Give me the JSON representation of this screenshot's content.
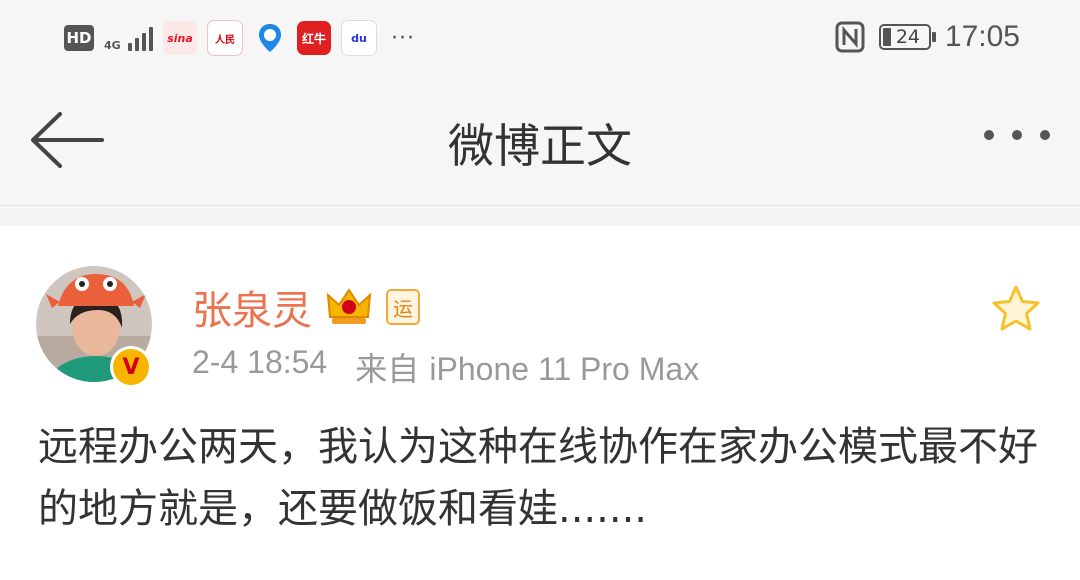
{
  "status_bar": {
    "hd_label": "HD",
    "network": "4G",
    "apps": [
      {
        "icon": "sina-icon",
        "label": "sina",
        "color": "#e6162d"
      },
      {
        "icon": "renminwang-icon",
        "label": "人民",
        "color": "#d7000f"
      },
      {
        "icon": "location-pin-icon",
        "label": "",
        "color": "#1e88e5"
      },
      {
        "icon": "app-red-icon",
        "label": "红牛",
        "color": "#e02020"
      },
      {
        "icon": "baidu-icon",
        "label": "du",
        "color": "#2932e1"
      }
    ],
    "more_dots": "···",
    "battery": "24",
    "time": "17:05"
  },
  "nav": {
    "title": "微博正文"
  },
  "post": {
    "username": "张泉灵",
    "vip_badge_icon": "crown-icon",
    "tag_label": "运",
    "verified_label": "V",
    "time": "2-4 18:54",
    "source_prefix": "来自",
    "device": "iPhone 11 Pro Max",
    "text": "远程办公两天，我认为这种在线协作在家办公模式最不好的地方就是，还要做饭和看娃......."
  },
  "colors": {
    "username": "#eb7350",
    "meta": "#999999",
    "text": "#333333",
    "star": "#f7c12b"
  }
}
